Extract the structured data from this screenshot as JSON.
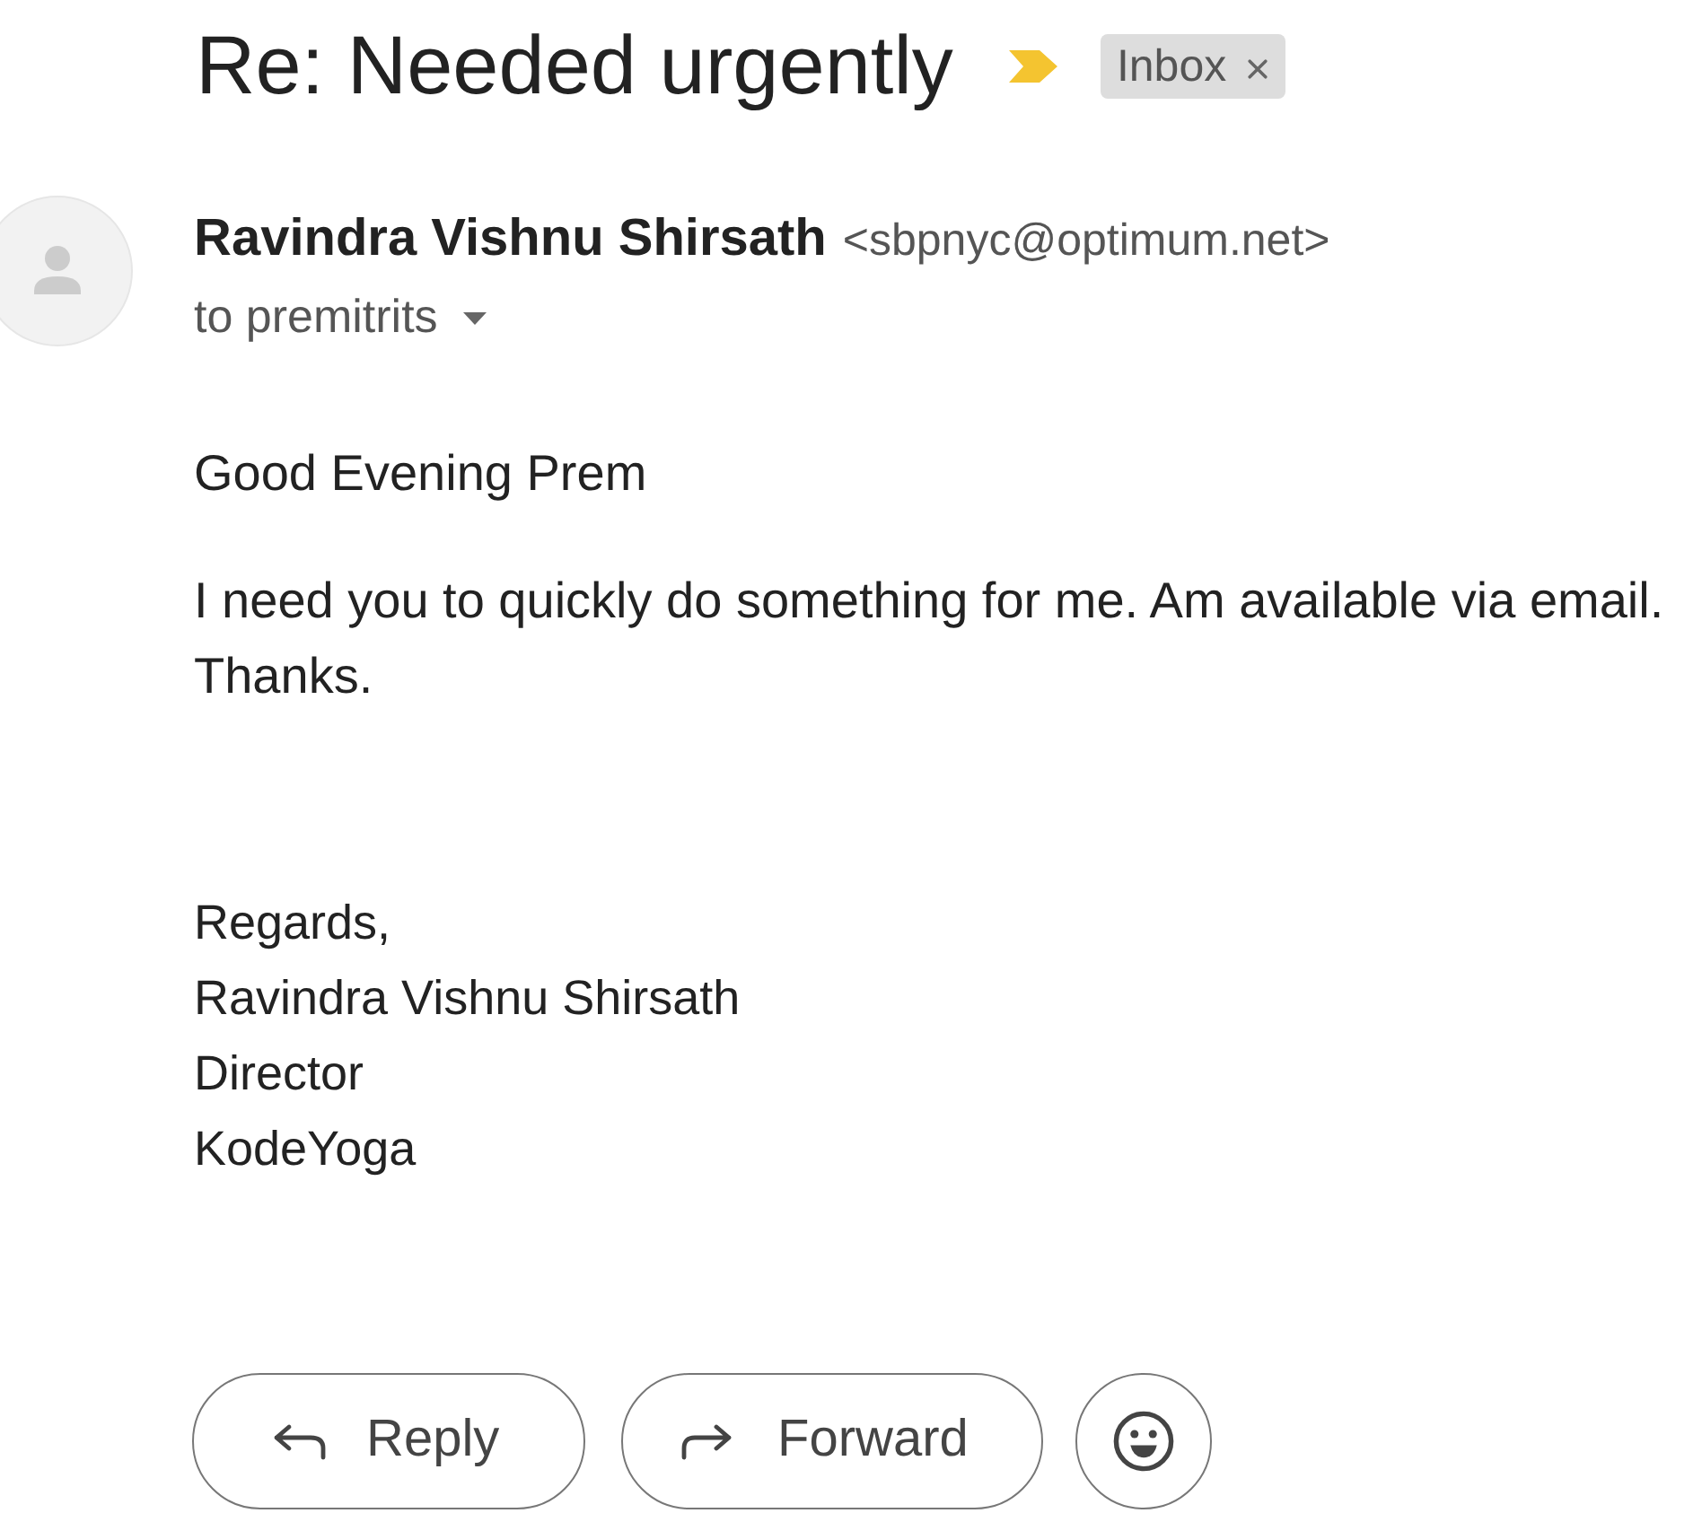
{
  "subject": "Re: Needed urgently",
  "important": true,
  "label_chip": {
    "label": "Inbox",
    "removable": true
  },
  "sender": {
    "name": "Ravindra Vishnu Shirsath",
    "email": "<sbpnyc@optimum.net>",
    "recipient": "to premitrits"
  },
  "body": {
    "paragraphs": [
      [
        "Good Evening Prem"
      ],
      [
        "I need you to quickly do something for me. Am available via email.",
        "Thanks."
      ]
    ],
    "signature": [
      "Regards,",
      "Ravindra Vishnu Shirsath",
      "Director",
      "KodeYoga"
    ]
  },
  "actions": [
    {
      "kind": "reply",
      "label": "Reply"
    },
    {
      "kind": "forward",
      "label": "Forward"
    },
    {
      "kind": "emoji"
    }
  ]
}
